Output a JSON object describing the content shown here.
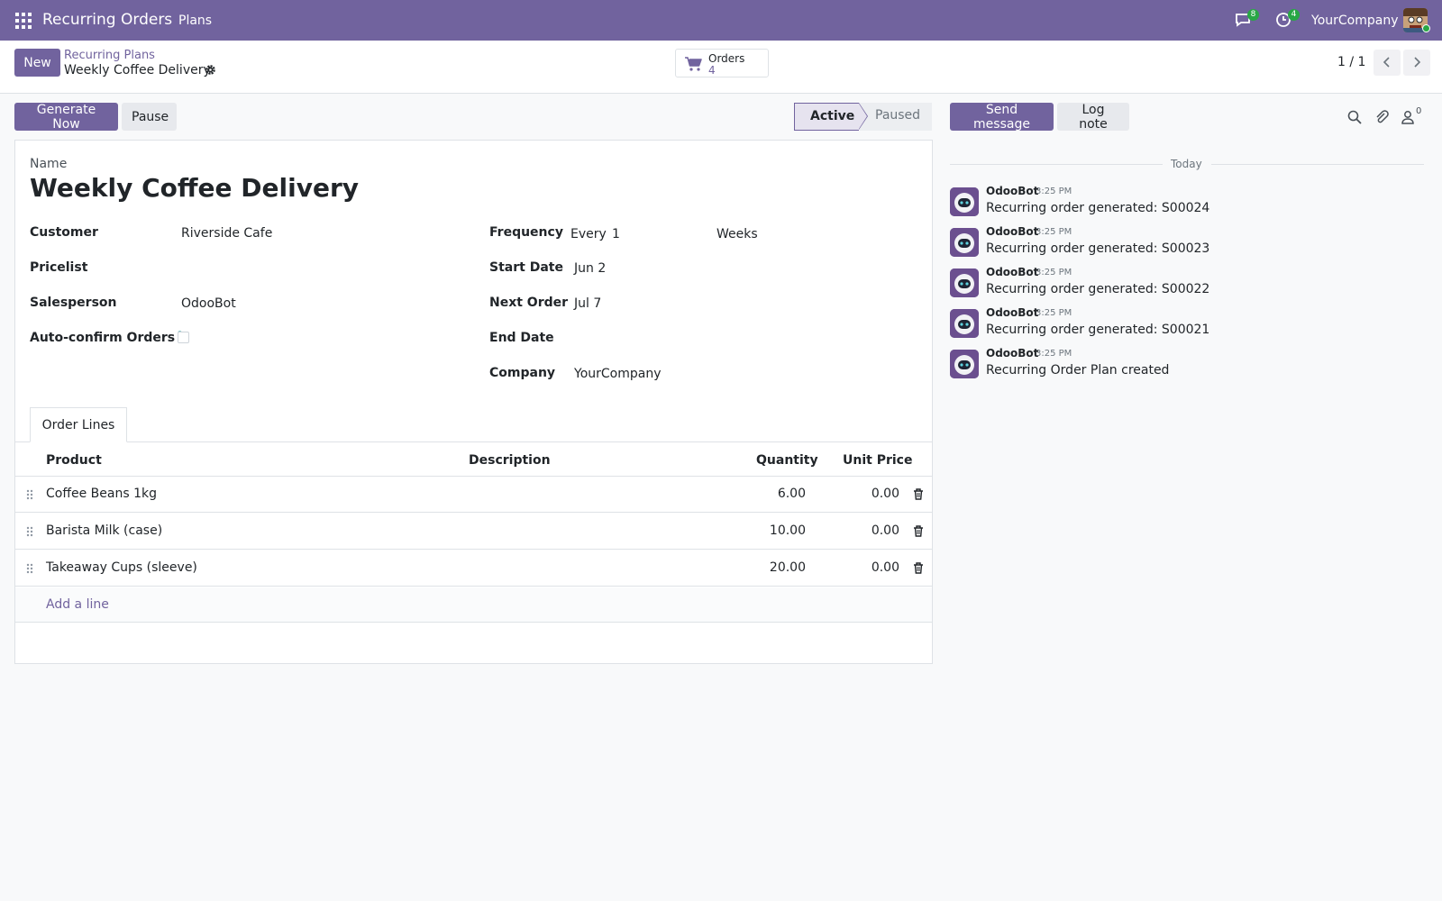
{
  "navbar": {
    "title": "Recurring Orders",
    "menu_plans": "Plans",
    "messages_badge": "8",
    "activities_badge": "4",
    "company": "YourCompany"
  },
  "control": {
    "new_label": "New",
    "breadcrumb_parent": "Recurring Plans",
    "breadcrumb_current": "Weekly Coffee Delivery",
    "smart_orders_label": "Orders",
    "smart_orders_count": "4",
    "pager": "1 / 1"
  },
  "statusbar": {
    "generate_label": "Generate Now",
    "pause_label": "Pause",
    "stages": [
      "Active",
      "Paused"
    ],
    "current_stage": "Active"
  },
  "form": {
    "name_label": "Name",
    "name": "Weekly Coffee Delivery",
    "customer_label": "Customer",
    "customer": "Riverside Cafe",
    "pricelist_label": "Pricelist",
    "pricelist": "",
    "salesperson_label": "Salesperson",
    "salesperson": "OdooBot",
    "autoconfirm_label": "Auto-confirm Orders",
    "autoconfirm_help": "?",
    "frequency_label": "Frequency",
    "frequency_every": "Every",
    "frequency_interval": "1",
    "frequency_unit": "Weeks",
    "start_date_label": "Start Date",
    "start_date": "Jun 2",
    "next_order_label": "Next Order",
    "next_order": "Jul 7",
    "end_date_label": "End Date",
    "end_date": "",
    "company_label": "Company",
    "company": "YourCompany"
  },
  "lines": {
    "tab_label": "Order Lines",
    "headers": {
      "product": "Product",
      "description": "Description",
      "quantity": "Quantity",
      "unit_price": "Unit Price"
    },
    "rows": [
      {
        "product": "Coffee Beans 1kg",
        "description": "",
        "quantity": "6.00",
        "unit_price": "0.00"
      },
      {
        "product": "Barista Milk (case)",
        "description": "",
        "quantity": "10.00",
        "unit_price": "0.00"
      },
      {
        "product": "Takeaway Cups (sleeve)",
        "description": "",
        "quantity": "20.00",
        "unit_price": "0.00"
      }
    ],
    "add_line": "Add a line"
  },
  "chatter": {
    "send_message_label": "Send message",
    "log_note_label": "Log note",
    "followers_count": "0",
    "date_separator": "Today",
    "messages": [
      {
        "author": "OdooBot",
        "time": "3:25 PM",
        "body": "Recurring order generated: S00024"
      },
      {
        "author": "OdooBot",
        "time": "3:25 PM",
        "body": "Recurring order generated: S00023"
      },
      {
        "author": "OdooBot",
        "time": "3:25 PM",
        "body": "Recurring order generated: S00022"
      },
      {
        "author": "OdooBot",
        "time": "3:25 PM",
        "body": "Recurring order generated: S00021"
      },
      {
        "author": "OdooBot",
        "time": "3:25 PM",
        "body": "Recurring Order Plan created"
      }
    ]
  },
  "colors": {
    "brand": "#71639e",
    "badge": "#28a745"
  }
}
